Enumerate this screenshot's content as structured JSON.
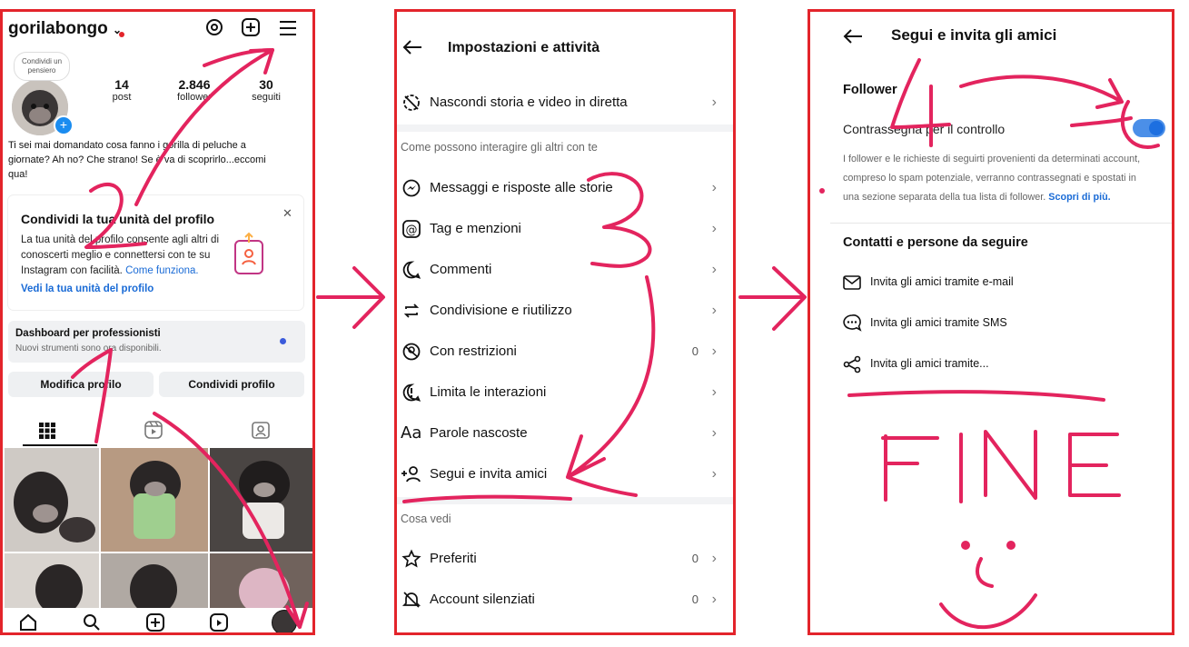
{
  "panel1": {
    "username": "gorilabongo",
    "thought_bubble": "Condividi un pensiero",
    "stats": [
      {
        "value": "14",
        "label": "post"
      },
      {
        "value": "2.846",
        "label": "follower"
      },
      {
        "value": "30",
        "label": "seguiti"
      }
    ],
    "bio": "Ti sei mai domandato cosa fanno i gorilla di peluche  a giornate? Ah no? Che strano! Se è va di scoprirlo...eccomi qua!",
    "card": {
      "title": "Condividi la tua unità del profilo",
      "text": "La tua unità del profilo consente agli altri di conoscerti meglio e connettersi con te su Instagram con facilità.",
      "link_inline": "Come funziona.",
      "link": "Vedi la tua unità del profilo"
    },
    "dashboard": {
      "title": "Dashboard per professionisti",
      "subtitle": "Nuovi strumenti sono ora disponibili."
    },
    "buttons": {
      "edit": "Modifica profilo",
      "share": "Condividi profilo"
    }
  },
  "panel2": {
    "title": "Impostazioni e attività",
    "row_top": "Nascondi storia e video in diretta",
    "section1": "Come possono interagire gli altri con te",
    "rows": [
      {
        "label": "Messaggi e risposte alle storie",
        "count": ""
      },
      {
        "label": "Tag e menzioni",
        "count": ""
      },
      {
        "label": "Commenti",
        "count": ""
      },
      {
        "label": "Condivisione e riutilizzo",
        "count": ""
      },
      {
        "label": "Con restrizioni",
        "count": "0"
      },
      {
        "label": "Limita le interazioni",
        "count": ""
      },
      {
        "label": "Parole nascoste",
        "count": ""
      },
      {
        "label": "Segui e invita amici",
        "count": ""
      }
    ],
    "section2": "Cosa vedi",
    "rows2": [
      {
        "label": "Preferiti",
        "count": "0"
      },
      {
        "label": "Account silenziati",
        "count": "0"
      }
    ]
  },
  "panel3": {
    "title": "Segui e invita gli amici",
    "section_follower": "Follower",
    "toggle_label": "Contrassegna per il controllo",
    "toggle_on": true,
    "description": "I follower e le richieste di seguirti provenienti da determinati account, compreso lo spam potenziale, verranno contrassegnati e spostati in una sezione separata della tua lista di follower.",
    "description_link": "Scopri di più.",
    "section_contacts": "Contatti e persone da seguire",
    "invites": [
      "Invita gli amici tramite e-mail",
      "Invita gli amici tramite SMS",
      "Invita gli amici tramite..."
    ]
  },
  "annotations": {
    "step1": "1",
    "step2": "2",
    "step3": "3",
    "step4": "4",
    "end": "FINE"
  },
  "colors": {
    "annotation": "#e3245e",
    "frame": "#e3242b",
    "accent": "#1a6bd6"
  }
}
